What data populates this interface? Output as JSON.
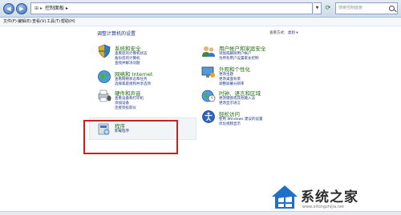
{
  "address_bar": {
    "back_icon": "back-arrow-icon",
    "forward_icon": "forward-arrow-icon",
    "path_prefix": "⊞ ▸",
    "path": "控制面板 ▸",
    "search_placeholder": "搜索控制面板"
  },
  "menu": [
    "文件(F)",
    "编辑(E)",
    "查看(V)",
    "工具(T)",
    "帮助(H)"
  ],
  "main": {
    "title": "调整计算机的设置",
    "view_by_label": "查看方式:",
    "view_by_value": "类别 ▾",
    "categories": [
      {
        "title": "系统和安全",
        "icon": "shield-icon",
        "links": [
          "查看您的计算机状态",
          "备份您的计算机",
          "查找并解决问题"
        ]
      },
      {
        "title": "网络和 Internet",
        "icon": "network-globe-icon",
        "links": [
          "查看网络状态和任务",
          "选择家庭组和共享选项"
        ]
      },
      {
        "title": "硬件和声音",
        "icon": "printer-speaker-icon",
        "links": [
          "查看设备和打印机",
          "添加设备",
          "连接到投影仪"
        ]
      },
      {
        "title": "程序",
        "icon": "programs-icon",
        "links": [
          "卸载程序"
        ]
      },
      {
        "title": "用户帐户和家庭安全",
        "icon": "users-icon",
        "links": [
          "添加或删除用户帐户",
          "为所有用户设置家长控制"
        ]
      },
      {
        "title": "外观和个性化",
        "icon": "appearance-icon",
        "links": [
          "更改主题",
          "更改桌面背景",
          "调整屏幕分辨率"
        ]
      },
      {
        "title": "时钟、语言和区域",
        "icon": "clock-globe-icon",
        "links": [
          "更改键盘或其他输入法",
          "更改显示语言"
        ]
      },
      {
        "title": "轻松访问",
        "icon": "ease-of-access-icon",
        "links": [
          "使用 Windows 建议的设置",
          "优化视频显示"
        ]
      }
    ]
  },
  "watermark": {
    "text": "系统之家",
    "sub": "www.xitongzhijia.net"
  },
  "colors": {
    "category_title": "#1e6e0f",
    "link": "#1e3287",
    "highlight": "#c62020"
  }
}
